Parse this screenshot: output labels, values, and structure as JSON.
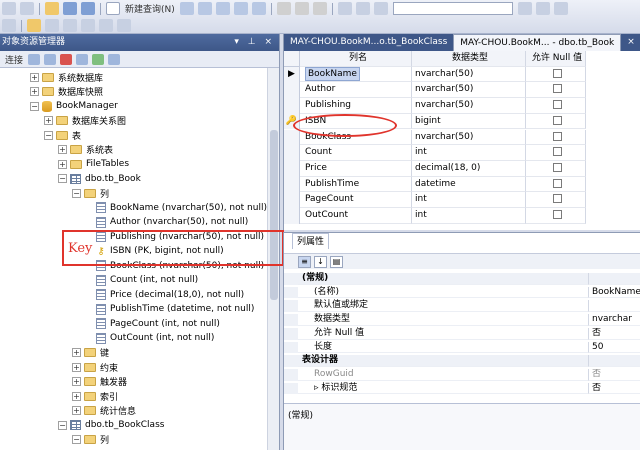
{
  "toolbar": {
    "query_label": "新建查询(N)"
  },
  "object_explorer": {
    "title": "对象资源管理器",
    "title_controls": "▾ ⊥ ×",
    "connect_label": "连接",
    "tree": [
      {
        "label": "系统数据库",
        "type": "folder",
        "exp": "+",
        "indent": 0
      },
      {
        "label": "数据库快照",
        "type": "folder",
        "exp": "+",
        "indent": 0
      },
      {
        "label": "BookManager",
        "type": "db",
        "exp": "−",
        "indent": 0
      },
      {
        "label": "数据库关系图",
        "type": "folder",
        "exp": "+",
        "indent": 1
      },
      {
        "label": "表",
        "type": "folder",
        "exp": "−",
        "indent": 1
      },
      {
        "label": "系统表",
        "type": "folder",
        "exp": "+",
        "indent": 2
      },
      {
        "label": "FileTables",
        "type": "folder",
        "exp": "+",
        "indent": 2
      },
      {
        "label": "dbo.tb_Book",
        "type": "table",
        "exp": "−",
        "indent": 2
      },
      {
        "label": "列",
        "type": "folder",
        "exp": "−",
        "indent": 3
      },
      {
        "label": "BookName (nvarchar(50), not null)",
        "type": "col",
        "exp": "",
        "indent": 4
      },
      {
        "label": "Author (nvarchar(50), not null)",
        "type": "col",
        "exp": "",
        "indent": 4
      },
      {
        "label": "Publishing (nvarchar(50), not null)",
        "type": "col",
        "exp": "",
        "indent": 4
      },
      {
        "label": "ISBN (PK, bigint, not null)",
        "type": "key",
        "exp": "",
        "indent": 4
      },
      {
        "label": "BookClass (nvarchar(50), not null)",
        "type": "col",
        "exp": "",
        "indent": 4
      },
      {
        "label": "Count (int, not null)",
        "type": "col",
        "exp": "",
        "indent": 4
      },
      {
        "label": "Price (decimal(18,0), not null)",
        "type": "col",
        "exp": "",
        "indent": 4
      },
      {
        "label": "PublishTime (datetime, not null)",
        "type": "col",
        "exp": "",
        "indent": 4
      },
      {
        "label": "PageCount (int, not null)",
        "type": "col",
        "exp": "",
        "indent": 4
      },
      {
        "label": "OutCount (int, not null)",
        "type": "col",
        "exp": "",
        "indent": 4
      },
      {
        "label": "键",
        "type": "folder",
        "exp": "+",
        "indent": 3
      },
      {
        "label": "约束",
        "type": "folder",
        "exp": "+",
        "indent": 3
      },
      {
        "label": "触发器",
        "type": "folder",
        "exp": "+",
        "indent": 3
      },
      {
        "label": "索引",
        "type": "folder",
        "exp": "+",
        "indent": 3
      },
      {
        "label": "统计信息",
        "type": "folder",
        "exp": "+",
        "indent": 3
      },
      {
        "label": "dbo.tb_BookClass",
        "type": "table",
        "exp": "−",
        "indent": 2
      },
      {
        "label": "列",
        "type": "folder",
        "exp": "−",
        "indent": 3
      }
    ],
    "annotation_label": "Key"
  },
  "designer": {
    "tabs": [
      {
        "label": "MAY-CHOU.BookM...o.tb_BookClass",
        "active": false
      },
      {
        "label": "MAY-CHOU.BookM... - dbo.tb_Book",
        "active": true
      },
      {
        "label": "×",
        "active": false
      }
    ],
    "headers": [
      "",
      "列名",
      "数据类型",
      "允许 Null 值"
    ],
    "rows": [
      {
        "marker": "▶",
        "name": "BookName",
        "type": "nvarchar(50)",
        "selected": true
      },
      {
        "marker": "",
        "name": "Author",
        "type": "nvarchar(50)"
      },
      {
        "marker": "",
        "name": "Publishing",
        "type": "nvarchar(50)"
      },
      {
        "marker": "🔑",
        "name": "ISBN",
        "type": "bigint"
      },
      {
        "marker": "",
        "name": "BookClass",
        "type": "nvarchar(50)"
      },
      {
        "marker": "",
        "name": "Count",
        "type": "int"
      },
      {
        "marker": "",
        "name": "Price",
        "type": "decimal(18, 0)"
      },
      {
        "marker": "",
        "name": "PublishTime",
        "type": "datetime"
      },
      {
        "marker": "",
        "name": "PageCount",
        "type": "int"
      },
      {
        "marker": "",
        "name": "OutCount",
        "type": "int"
      }
    ]
  },
  "properties": {
    "tab_label": "列属性",
    "rows": [
      {
        "key": "(常规)",
        "value": "",
        "kind": "cat"
      },
      {
        "key": "(名称)",
        "value": "BookName"
      },
      {
        "key": "默认值或绑定",
        "value": ""
      },
      {
        "key": "数据类型",
        "value": "nvarchar"
      },
      {
        "key": "允许 Null 值",
        "value": "否"
      },
      {
        "key": "长度",
        "value": "50"
      },
      {
        "key": "表设计器",
        "value": "",
        "kind": "cat"
      },
      {
        "key": "RowGuid",
        "value": "否",
        "kind": "dim"
      },
      {
        "key": "▹ 标识规范",
        "value": "否"
      }
    ],
    "description": "(常规)"
  }
}
